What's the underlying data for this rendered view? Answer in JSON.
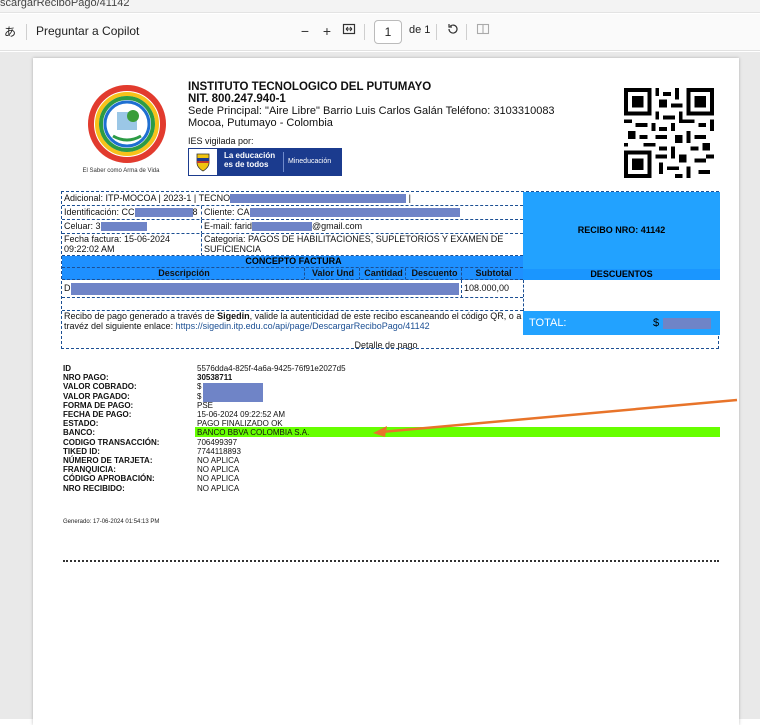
{
  "urlbar": {
    "text": "scargarReciboPago/41142"
  },
  "toolbar": {
    "copilot_label": "Preguntar a Copilot",
    "zoom_out": "−",
    "zoom_in": "+",
    "page_value": "1",
    "page_of": "de 1"
  },
  "header": {
    "institution": "INSTITUTO TECNOLOGICO DEL PUTUMAYO",
    "nit": "NIT. 800.247.940-1",
    "address_line": "Sede Principal: \"Aire Libre\" Barrio Luis Carlos Galán Teléfono: 3103310083",
    "city": "Mocoa, Putumayo - Colombia",
    "vigilada": "IES vigilada por:",
    "min_tagline": "La educación es de todos",
    "min_name": "Mineducación",
    "logo_caption": "El Saber como Arma de Vida",
    "seal_text": "INSTITUTO TECNOLOGICO DEL PUTUMAYO"
  },
  "invoice": {
    "adicional": "Adicional: ITP-MOCOA | 2023-1 | TECNO",
    "identificacion": "Identificación: CC",
    "identificacion_tail": "8",
    "cliente": "Cliente: CA",
    "celular": "Celuar: 3",
    "email": "E-mail: farid",
    "email_tail": "@gmail.com",
    "fecha": "Fecha factura: 15-06-2024 09:22:02 AM",
    "categoria": "Categoria: PAGOS DE HABILITACIONES, SUPLETORIOS Y EXAMEN DE SUFICIENCIA",
    "concepto_head": "CONCEPTO FACTURA",
    "col_desc": "Descripción",
    "col_valor": "Valor Und",
    "col_cant": "Cantidad",
    "col_desc2": "Descuento",
    "col_sub": "Subtotal",
    "item_prefix": "D",
    "item_subtotal": "108.000,00",
    "recibo": "RECIBO NRO: 41142",
    "descuentos": "DESCUENTOS",
    "total_label": "TOTAL:",
    "total_prefix": "$",
    "note_pre": "Recibo de pago generado a través de ",
    "note_brand": "Sigedin",
    "note_post": ", valide la autenticidad de este recibo escaneando el código QR, o a",
    "note_line2_pre": "travéz del siguiente enlace: ",
    "note_link": "https://sigedin.itp.edu.co/api/page/DescargarReciboPago/41142"
  },
  "detalle": {
    "title": "Detalle de pago",
    "rows": [
      {
        "label": "ID",
        "value": "5576dda4-825f-4a6a-9425-76f91e2027d5"
      },
      {
        "label": "NRO PAGO:",
        "value": "30538711"
      },
      {
        "label": "VALOR COBRADO:",
        "value": "$"
      },
      {
        "label": "VALOR PAGADO:",
        "value": "$"
      },
      {
        "label": "FORMA DE PAGO:",
        "value": "PSE"
      },
      {
        "label": "FECHA DE PAGO:",
        "value": "15-06-2024 09:22:52 AM"
      },
      {
        "label": "ESTADO:",
        "value": "PAGO FINALIZADO OK"
      },
      {
        "label": "BANCO:",
        "value": "BANCO BBVA COLOMBIA S.A."
      },
      {
        "label": "CODIGO TRANSACCIÓN:",
        "value": "706499397"
      },
      {
        "label": "TIKED ID:",
        "value": "7744118893"
      },
      {
        "label": "NÚMERO DE TARJETA:",
        "value": "NO APLICA"
      },
      {
        "label": "FRANQUICIA:",
        "value": "NO APLICA"
      },
      {
        "label": "CÓDIGO APROBACIÓN:",
        "value": "NO APLICA"
      },
      {
        "label": "NRO RECIBIDO:",
        "value": "NO APLICA"
      }
    ],
    "generado": "Generado: 17-06-2024 01:54:13 PM"
  },
  "colors": {
    "accent_blue": "#1e90ff",
    "status_green": "#66ff00",
    "arrow_orange": "#e8742a"
  }
}
